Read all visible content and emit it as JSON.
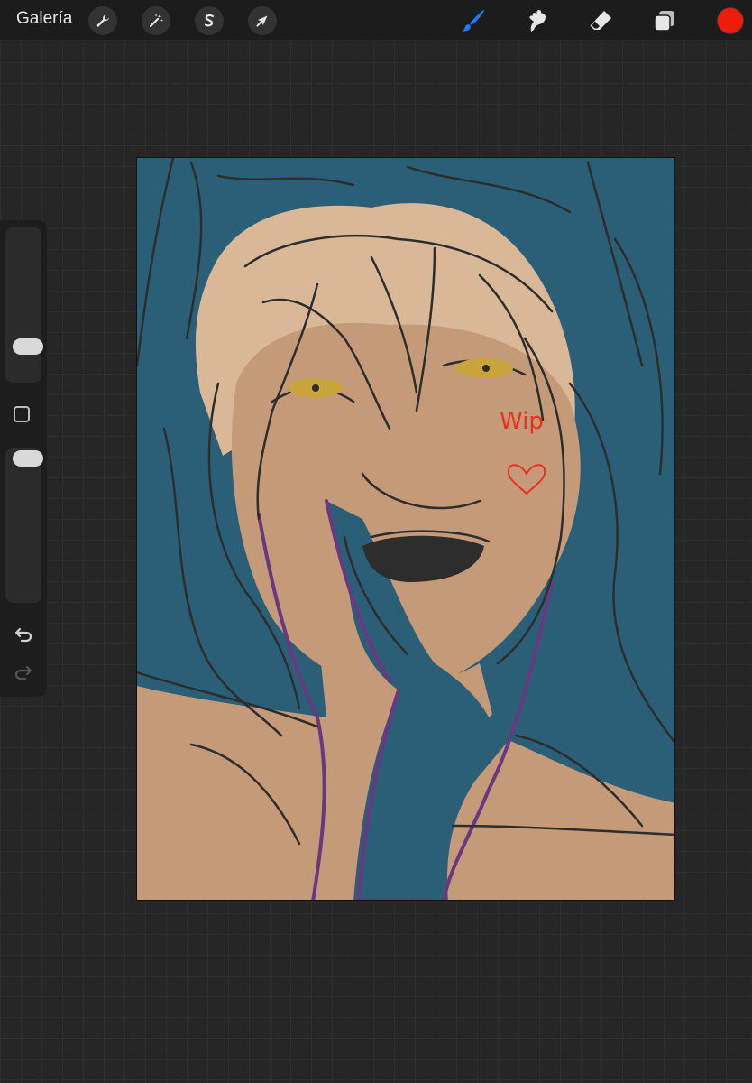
{
  "app": {
    "gallery_label": "Galería"
  },
  "toolbar": {
    "left_tools": [
      {
        "icon": "wrench-icon",
        "name": "actions"
      },
      {
        "icon": "magic-wand-icon",
        "name": "adjustments"
      },
      {
        "icon": "selection-s-icon",
        "name": "selection"
      },
      {
        "icon": "arrow-cursor-icon",
        "name": "transform"
      }
    ],
    "right_tools": [
      {
        "icon": "brush-icon",
        "name": "paint",
        "active": true
      },
      {
        "icon": "smudge-icon",
        "name": "smudge"
      },
      {
        "icon": "eraser-icon",
        "name": "eraser"
      },
      {
        "icon": "layers-icon",
        "name": "layers"
      }
    ],
    "current_color": "#ee1c0b",
    "active_tool_color": "#1e7cf2"
  },
  "sidebar": {
    "brush_size_level": 0.2,
    "opacity_level": 0.95
  },
  "canvas": {
    "annotation_text": "Wip",
    "colors": {
      "background": "#2b5f78",
      "skin": "#c59a78",
      "hair": "#d8b896",
      "sketch": "#2d2d2d",
      "outline_purple": "#6a3880",
      "eyes": "#c8a43a",
      "annotation": "#e8321e"
    }
  }
}
